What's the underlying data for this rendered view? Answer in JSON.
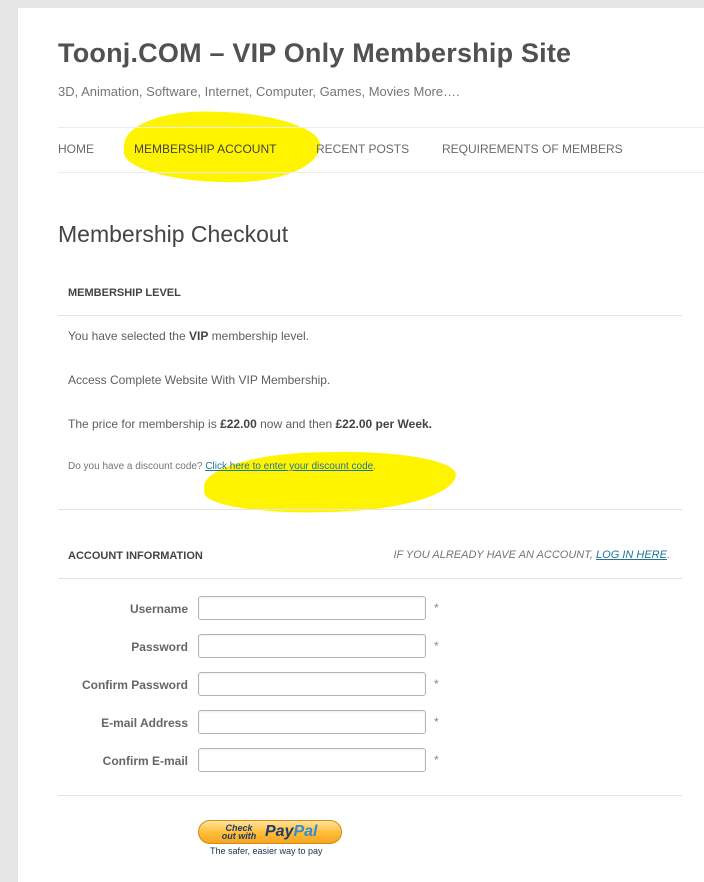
{
  "site": {
    "title": "Toonj.COM – VIP Only Membership Site",
    "description": "3D, Animation, Software, Internet, Computer, Games, Movies More…."
  },
  "nav": {
    "items": [
      "HOME",
      "MEMBERSHIP ACCOUNT",
      "RECENT POSTS",
      "REQUIREMENTS OF MEMBERS"
    ],
    "active_index": 1
  },
  "page": {
    "title": "Membership Checkout"
  },
  "membership_level": {
    "heading": "MEMBERSHIP LEVEL",
    "selected_prefix": "You have selected the ",
    "level_name": "VIP",
    "selected_suffix": " membership level.",
    "description": "Access Complete Website With VIP Membership.",
    "price_prefix": "The price for membership is ",
    "price_now": "£22.00",
    "price_middle": " now and then ",
    "price_recurring": "£22.00 per Week.",
    "discount_question": "Do you have a discount code? ",
    "discount_link": "Click here to enter your discount code",
    "discount_suffix": "."
  },
  "account_information": {
    "heading": "ACCOUNT INFORMATION",
    "login_prefix": "IF YOU ALREADY HAVE AN ACCOUNT, ",
    "login_link": "LOG IN HERE",
    "login_suffix": ".",
    "required_marker": "*",
    "fields": [
      {
        "label": "Username",
        "value": ""
      },
      {
        "label": "Password",
        "value": ""
      },
      {
        "label": "Confirm Password",
        "value": ""
      },
      {
        "label": "E-mail Address",
        "value": ""
      },
      {
        "label": "Confirm E-mail",
        "value": ""
      }
    ]
  },
  "paypal": {
    "checkout_text": "Check out with",
    "brand_pay": "Pay",
    "brand_pal": "Pal",
    "tagline": "The safer, easier way to pay"
  },
  "colors": {
    "highlight": "#fff400",
    "link": "#21759b",
    "paypal_orange": "#ffbc37",
    "paypal_navy": "#1f3b6b"
  }
}
